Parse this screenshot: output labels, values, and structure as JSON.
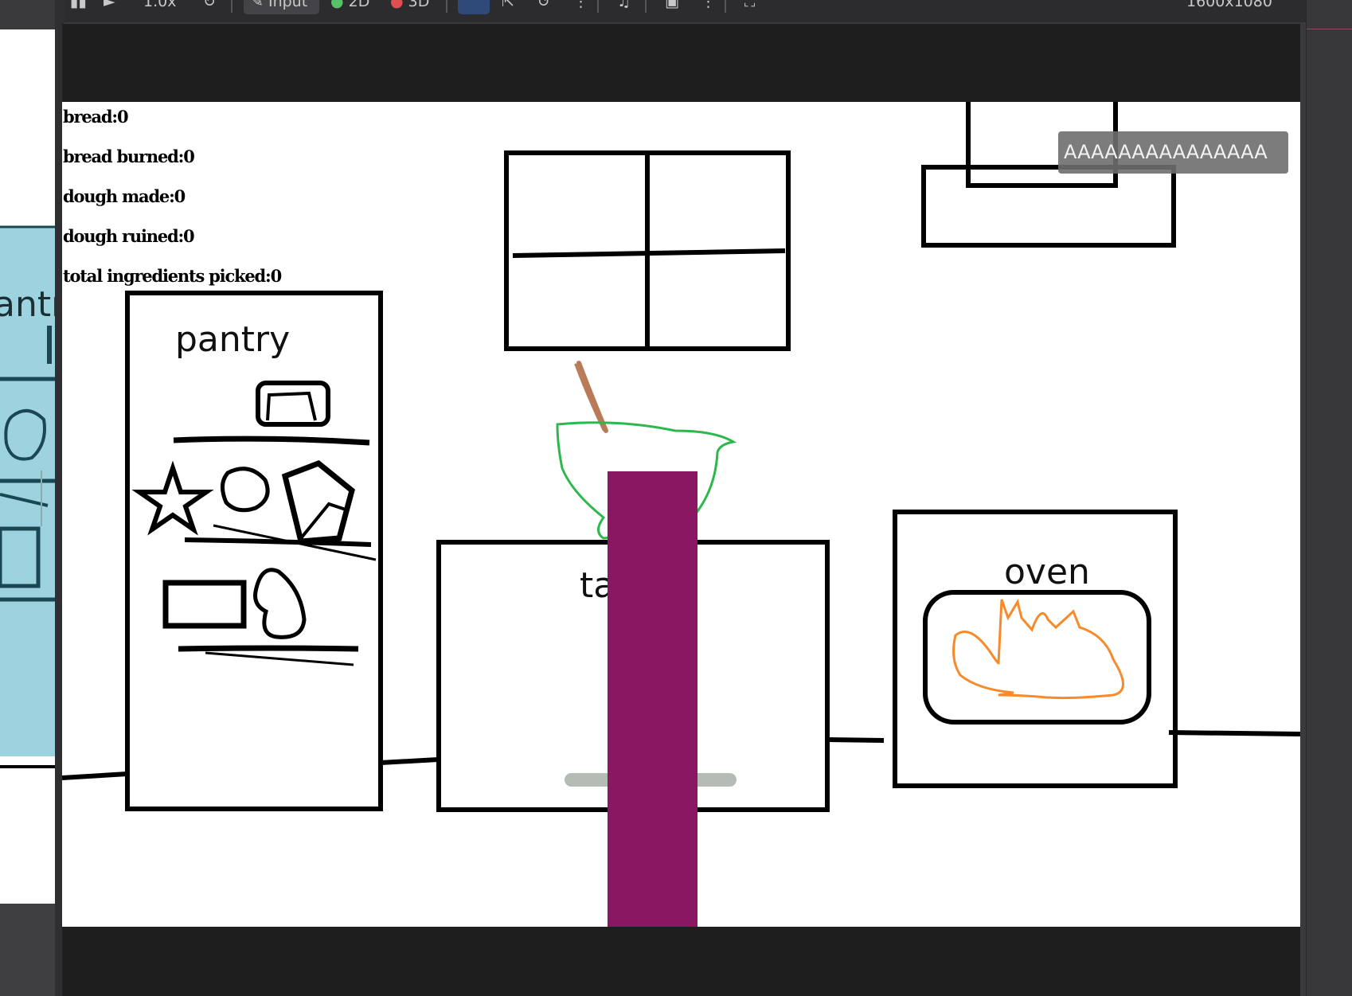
{
  "editor": {
    "toolbar_items": [
      "1.0x",
      "Input",
      "2D",
      "3D"
    ],
    "resolution_label": "1600x1080"
  },
  "game": {
    "stats": [
      {
        "label": "bread:",
        "value": "0"
      },
      {
        "label": "bread burned:",
        "value": "0"
      },
      {
        "label": "dough made:",
        "value": "0"
      },
      {
        "label": "dough ruined:",
        "value": "0"
      },
      {
        "label": "total ingredients picked:",
        "value": "0"
      }
    ],
    "labels": {
      "pantry": "pantry",
      "table": "ta",
      "oven": "oven"
    },
    "speech_bubble": "AAAAAAAAAAAAAAA",
    "dough_progress": 0,
    "colors": {
      "player": "#8a1761",
      "bowl": "#2db84b",
      "spoon": "#b97a57",
      "fire": "#f78a2a",
      "outline": "#000000"
    }
  },
  "background_panel": {
    "partial_label": "antr"
  }
}
